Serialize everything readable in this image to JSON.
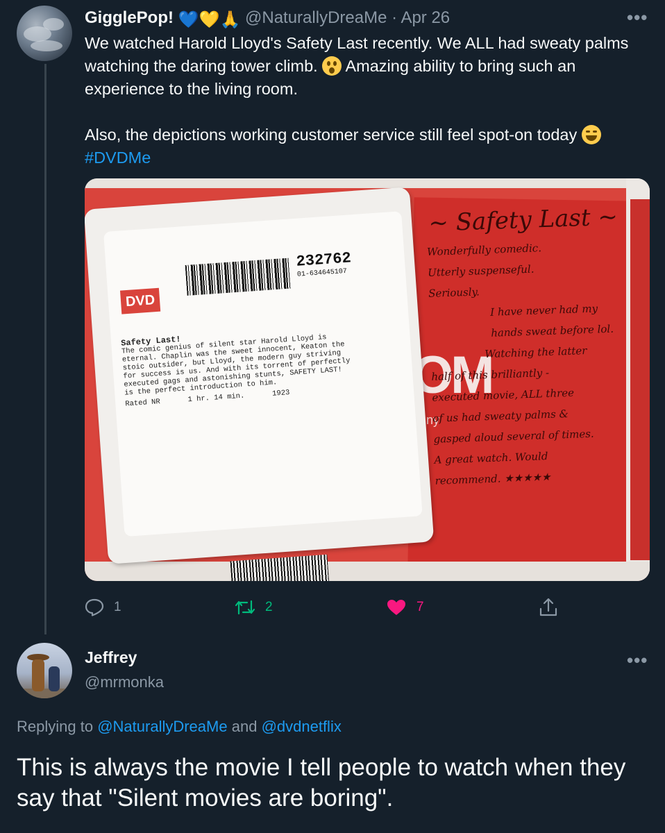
{
  "tweet": {
    "author_name": "GigglePop!",
    "name_emojis": "💙💛🙏",
    "handle": "@NaturallyDreaMe",
    "separator": "·",
    "date": "Apr 26",
    "text_line1": "We watched Harold Lloyd's Safety Last recently. We ALL had sweaty palms",
    "text_line2a": "watching the daring tower climb.",
    "text_line2b": "Amazing ability to bring such an",
    "text_line3": "experience to the living room.",
    "text_line4": "Also, the depictions working customer service still feel spot-on today",
    "hashtag": "#DVDMe",
    "photo": {
      "disc_number": "232762",
      "disc_id": "01-634645107",
      "dvd_logo": "DVD",
      "label_title": "Safety Last!",
      "label_lines": [
        "The comic genius of silent star Harold Lloyd is",
        "eternal. Chaplin was the sweet innocent, Keaton the",
        "stoic outsider, but Lloyd, the modern guy striving",
        "for success is us. And with its torrent of perfectly",
        "executed gags and astonishing stunts, SAFETY LAST!",
        "is the perfect introduction to him."
      ],
      "label_runtime": "1 hr. 14 min.",
      "label_year": "1923",
      "label_rating": "Rated NR",
      "big_text": "OM",
      "small_text": "ny",
      "note_title": "~ Safety Last ~",
      "note_lines": [
        "Wonderfully comedic.",
        "Utterly suspenseful.",
        "Seriously.",
        "I have never had my",
        "hands sweat before lol.",
        "Watching the latter",
        "half of this brilliantly -",
        "executed movie, ALL three",
        "of us had sweaty palms &",
        "gasped aloud several of times.",
        "A great watch. Would",
        "recommend. ★★★★★"
      ]
    },
    "actions": {
      "reply_count": "1",
      "retweet_count": "2",
      "like_count": "7"
    },
    "colors": {
      "retweet": "#00ba7c",
      "like": "#f91880",
      "link": "#1d9bf0",
      "muted": "#8b98a5"
    }
  },
  "reply": {
    "author_name": "Jeffrey",
    "handle": "@mrmonka",
    "replying_prefix": "Replying to",
    "replying_to_1": "@NaturallyDreaMe",
    "replying_and": "and",
    "replying_to_2": "@dvdnetflix",
    "text": "This is always the movie I tell people to watch when they say that \"Silent movies are boring\"."
  },
  "more_label": "•••"
}
